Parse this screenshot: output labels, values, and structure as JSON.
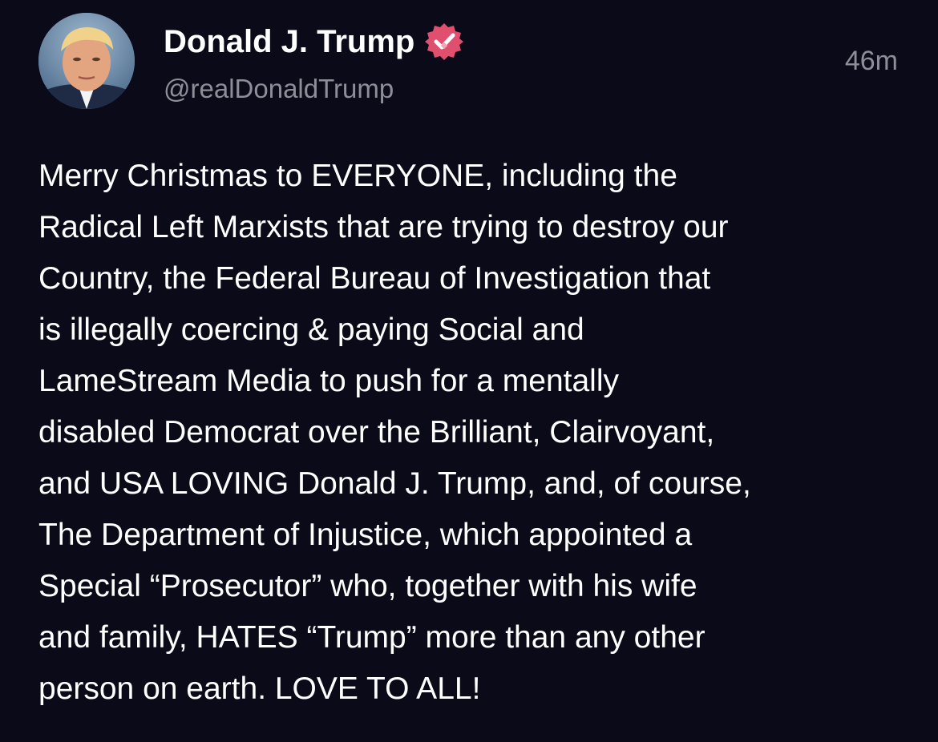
{
  "post": {
    "author_name": "Donald J. Trump",
    "handle": "@realDonaldTrump",
    "timestamp": "46m",
    "verified_icon": "verified-badge-icon",
    "body": "Merry Christmas to EVERYONE, including the\nRadical Left Marxists that are trying to destroy our\nCountry, the Federal Bureau of Investigation that\nis illegally coercing & paying Social and\nLameStream Media to push for a mentally\ndisabled Democrat over the Brilliant, Clairvoyant,\nand USA LOVING Donald J. Trump, and, of course,\nThe Department of Injustice, which appointed a\nSpecial “Prosecutor” who, together with his wife\nand family, HATES “Trump” more than any other\nperson on earth. LOVE TO ALL!"
  },
  "colors": {
    "background": "#0b0a19",
    "text_primary": "#ffffff",
    "text_secondary": "#8e8e99",
    "verified_badge": "#e04f6e"
  }
}
